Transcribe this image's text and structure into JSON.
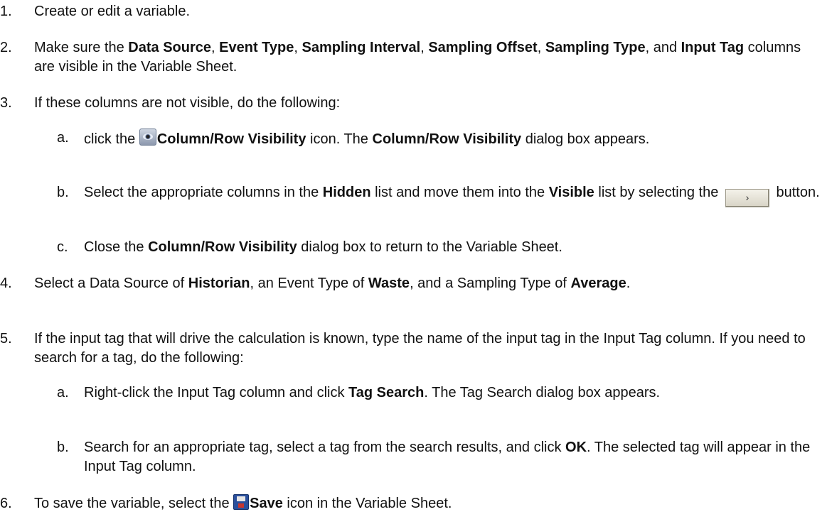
{
  "steps": {
    "s1": {
      "num": "1.",
      "text": "Create or edit a variable."
    },
    "s2": {
      "num": "2.",
      "t1": "Make sure the ",
      "b1": "Data Source",
      "t2": ", ",
      "b2": "Event Type",
      "t3": ", ",
      "b3": "Sampling Interval",
      "t4": ", ",
      "b4": "Sampling Offset",
      "t5": ", ",
      "b5": "Sampling Type",
      "t6": ", and ",
      "b6": "Input Tag",
      "t7": " columns are visible in the Variable Sheet."
    },
    "s3": {
      "num": "3.",
      "text": "If these columns are not visible, do the following:",
      "a": {
        "num": "a.",
        "t1": "click the ",
        "icon": "eye-icon",
        "b1": "Column/Row Visibility",
        "t2": " icon. The ",
        "b2": "Column/Row Visibility",
        "t3": " dialog box appears."
      },
      "b": {
        "num": "b.",
        "t1": "Select the appropriate columns in the ",
        "b1": "Hidden",
        "t2": " list and move them into the ",
        "b2": "Visible",
        "t3": " list by selecting the ",
        "button_label": "›",
        "t4": " button."
      },
      "c": {
        "num": "c.",
        "t1": "Close the ",
        "b1": "Column/Row Visibility",
        "t2": " dialog box to return to the Variable Sheet."
      }
    },
    "s4": {
      "num": "4.",
      "t1": "Select a Data Source of ",
      "b1": "Historian",
      "t2": ", an Event Type of ",
      "b2": "Waste",
      "t3": ", and a Sampling Type of ",
      "b3": "Average",
      "t4": "."
    },
    "s5": {
      "num": "5.",
      "text": "If the input tag that will drive the calculation is known, type the name of the input tag in the Input Tag column. If you need to search for a tag, do the following:",
      "a": {
        "num": "a.",
        "t1": "Right-click the Input Tag column and click ",
        "b1": "Tag Search",
        "t2": ". The Tag Search dialog box appears."
      },
      "b": {
        "num": "b.",
        "t1": "Search for an appropriate tag, select a tag from the search results, and click ",
        "b1": "OK",
        "t2": ". The selected tag will appear in the Input Tag column."
      }
    },
    "s6": {
      "num": "6.",
      "t1": "To save the variable, select the ",
      "icon": "save-icon",
      "b1": "Save",
      "t2": " icon in the Variable Sheet."
    }
  }
}
